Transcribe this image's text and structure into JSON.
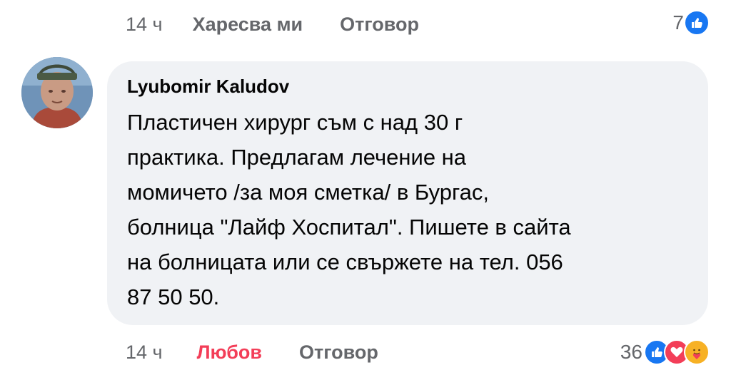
{
  "previous_comment": {
    "time": "14 ч",
    "like_label": "Харесва ми",
    "reply_label": "Отговор",
    "reaction_count": "7",
    "reaction_icons": [
      "like-icon"
    ]
  },
  "comment": {
    "author": "Lyubomir Kaludov",
    "text_lines": [
      "Пластичен хирург съм с над 30 г",
      "практика. Предлагам лечение на",
      "момичето /за моя сметка/ в Бургас,",
      "болница \"Лайф Хоспитал\". Пишете в сайта",
      "на болницата или се свържете на тел. 056",
      "87 50 50."
    ],
    "time": "14 ч",
    "reaction_label": "Любов",
    "reply_label": "Отговор",
    "reaction_count": "36",
    "reaction_icons": [
      "like-icon",
      "love-icon",
      "care-icon"
    ]
  },
  "colors": {
    "like_blue": "#1877f2",
    "love_red": "#f33e58",
    "care_yellow": "#f7b125",
    "bubble_bg": "#f0f2f5",
    "meta_gray": "#65676b"
  }
}
